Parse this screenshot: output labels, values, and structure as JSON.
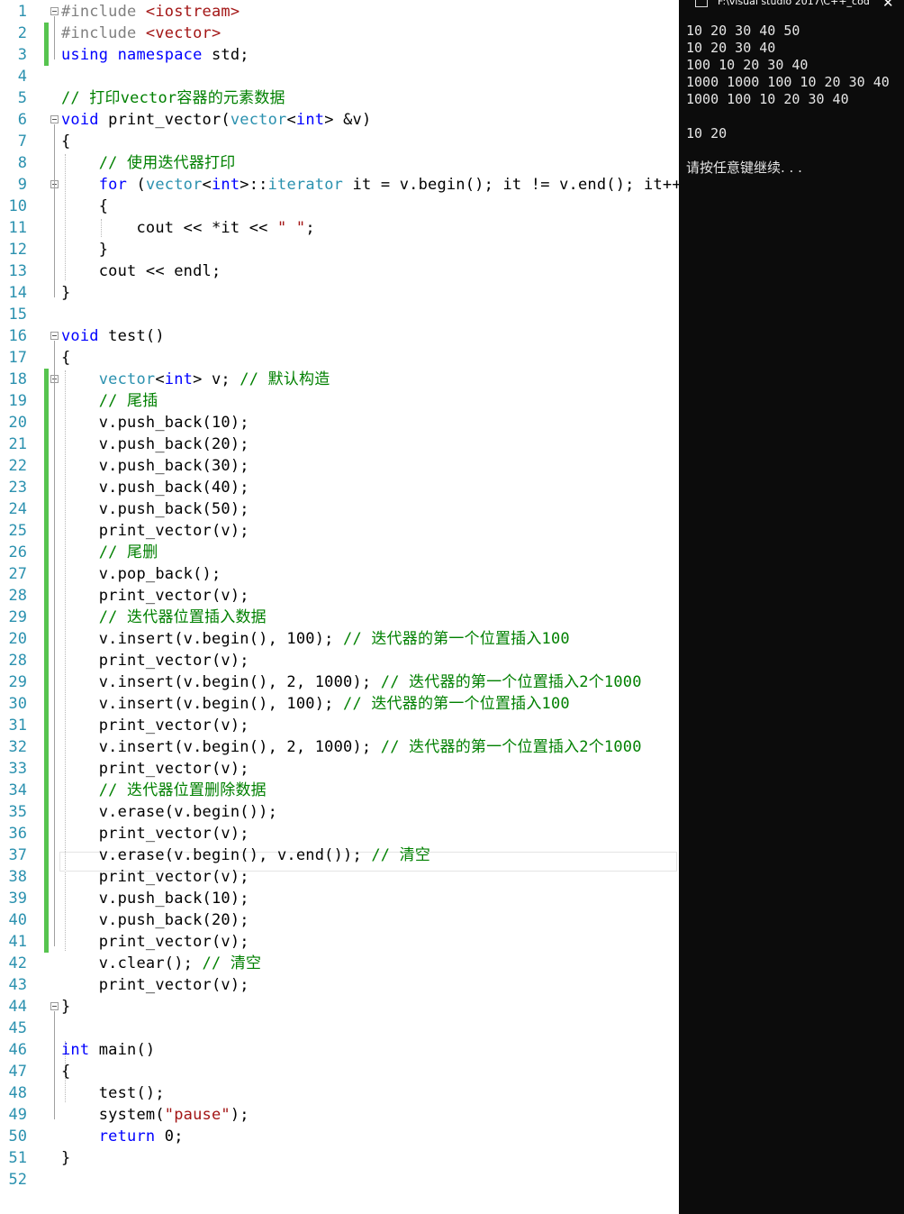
{
  "editor": {
    "line_numbers": [
      "1",
      "2",
      "3",
      "4",
      "5",
      "6",
      "7",
      "8",
      "9",
      "10",
      "11",
      "12",
      "13",
      "14",
      "15",
      "16",
      "17",
      "18",
      "19",
      "20",
      "21",
      "22",
      "23",
      "24",
      "25",
      "26",
      "27",
      "28",
      "29",
      "20",
      "28",
      "29",
      "30",
      "31",
      "32",
      "33",
      "34",
      "35",
      "36",
      "37",
      "38",
      "39",
      "40",
      "41",
      "42",
      "43",
      "44",
      "45",
      "46",
      "47",
      "48",
      "49",
      "50",
      "51",
      "52"
    ],
    "code_lines": [
      "#include <iostream>",
      "#include <vector>",
      "using namespace std;",
      "",
      "// 打印vector容器的元素数据",
      "void print_vector(vector<int> &v)",
      "{",
      "    // 使用迭代器打印",
      "    for (vector<int>::iterator it = v.begin(); it != v.end(); it++)",
      "    {",
      "        cout << *it << \" \";",
      "    }",
      "    cout << endl;",
      "}",
      "",
      "void test()",
      "{",
      "    vector<int> v; // 默认构造",
      "    // 尾插",
      "    v.push_back(10);",
      "    v.push_back(20);",
      "    v.push_back(30);",
      "    v.push_back(40);",
      "    v.push_back(50);",
      "    print_vector(v);",
      "    // 尾删",
      "    v.pop_back();",
      "    print_vector(v);",
      "    // 迭代器位置插入数据",
      "    v.insert(v.begin(), 100); // 迭代器的第一个位置插入100",
      "    print_vector(v);",
      "    v.insert(v.begin(), 2, 1000); // 迭代器的第一个位置插入2个1000",
      "    v.insert(v.begin(), 100); // 迭代器的第一个位置插入100",
      "    print_vector(v);",
      "    v.insert(v.begin(), 2, 1000); // 迭代器的第一个位置插入2个1000",
      "    print_vector(v);",
      "    // 迭代器位置删除数据",
      "    v.erase(v.begin());",
      "    print_vector(v);",
      "    v.erase(v.begin(), v.end()); // 清空",
      "    print_vector(v);",
      "    v.push_back(10);",
      "    v.push_back(20);",
      "    print_vector(v);",
      "    v.clear(); // 清空",
      "    print_vector(v);",
      "}",
      "",
      "int main()",
      "{",
      "    test();",
      "    system(\"pause\");",
      "    return 0;",
      "}",
      ""
    ]
  },
  "console": {
    "title": "F:\\visual studio 2017\\C++_cod",
    "close_glyph": "✕",
    "lines": [
      "10 20 30 40 50",
      "10 20 30 40",
      "100 10 20 30 40",
      "1000 1000 100 10 20 30 40",
      "1000 100 10 20 30 40",
      "",
      "10 20",
      "",
      "请按任意键继续. . ."
    ]
  },
  "colors": {
    "keyword": "#0000ff",
    "type": "#2b91af",
    "comment": "#008000",
    "string": "#a31515",
    "preprocessor": "#808080",
    "line_number": "#2b91af",
    "change_bar": "#57c44f",
    "console_bg": "#0c0c0c"
  }
}
